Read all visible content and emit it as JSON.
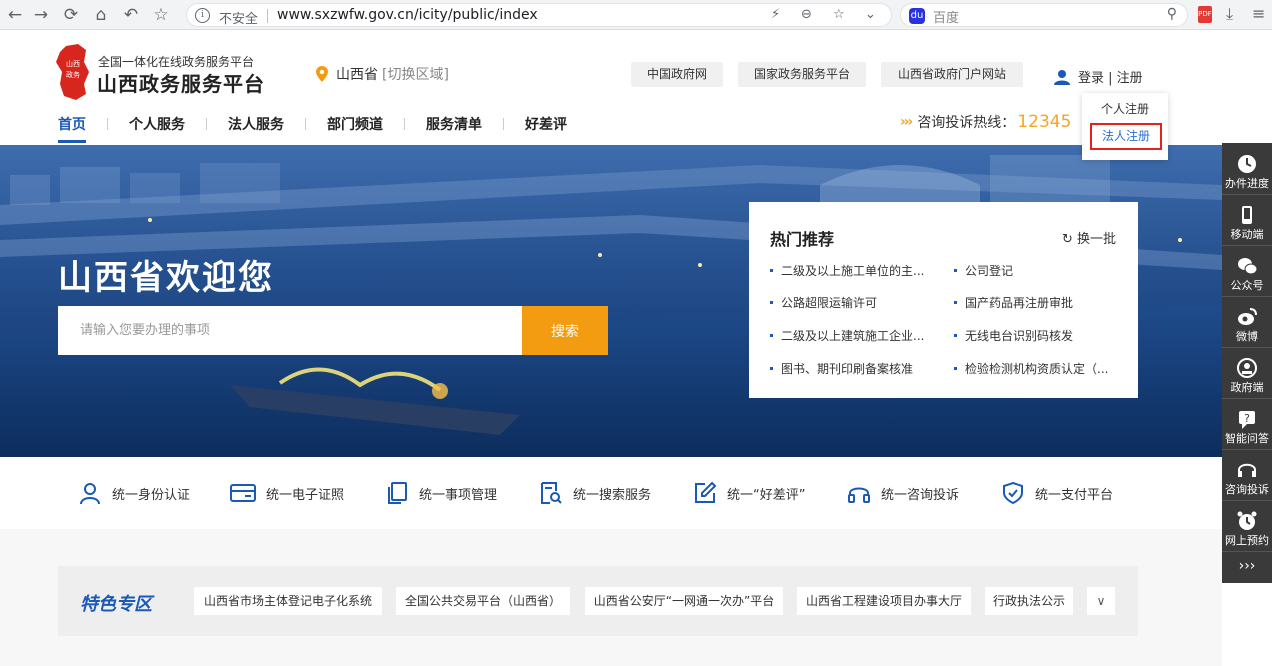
{
  "browser": {
    "insecure_label": "不安全",
    "url": "www.sxzwfw.gov.cn/icity/public/index",
    "search_engine": "百度"
  },
  "header": {
    "logo_subtitle": "全国一体化在线政务服务平台",
    "logo_title": "山西政务服务平台",
    "region": "山西省",
    "region_switch": "[切换区域]",
    "top_links": [
      "中国政府网",
      "国家政务服务平台",
      "山西省政府门户网站"
    ],
    "login": "登录 | 注册",
    "dropdown": {
      "personal": "个人注册",
      "corporate": "法人注册"
    },
    "hotline_label": "咨询投诉热线：",
    "hotline_number": "12345"
  },
  "nav": {
    "items": [
      "首页",
      "个人服务",
      "法人服务",
      "部门频道",
      "服务清单",
      "好差评"
    ]
  },
  "banner": {
    "welcome": "山西省欢迎您",
    "search_placeholder": "请输入您要办理的事项",
    "search_button": "搜索"
  },
  "hot": {
    "title": "热门推荐",
    "refresh": "换一批",
    "items": [
      "二级及以上施工单位的主...",
      "公司登记",
      "公路超限运输许可",
      "国产药品再注册审批",
      "二级及以上建筑施工企业...",
      "无线电台识别码核发",
      "图书、期刊印刷备案核准",
      "检验检测机构资质认定（..."
    ]
  },
  "services": [
    {
      "label": "统一身份认证",
      "icon": "user-icon"
    },
    {
      "label": "统一电子证照",
      "icon": "card-icon"
    },
    {
      "label": "统一事项管理",
      "icon": "documents-icon"
    },
    {
      "label": "统一搜索服务",
      "icon": "search-document-icon"
    },
    {
      "label": "统一“好差评”",
      "icon": "edit-icon"
    },
    {
      "label": "统一咨询投诉",
      "icon": "headset-icon"
    },
    {
      "label": "统一支付平台",
      "icon": "shield-check-icon"
    }
  ],
  "featured": {
    "label": "特色专区",
    "chips": [
      "山西省市场主体登记电子化系统",
      "全国公共交易平台（山西省）",
      "山西省公安厅“一网通一次办”平台",
      "山西省工程建设项目办事大厅",
      "行政执法公示"
    ]
  },
  "sidebar": {
    "items": [
      "办件进度",
      "移动端",
      "公众号",
      "微博",
      "政府端",
      "智能问答",
      "咨询投诉",
      "网上预约"
    ],
    "more": "›››"
  },
  "colors": {
    "primary": "#1a59b6",
    "accent": "#f39c12",
    "highlight_border": "#e3221b",
    "sidebar": "#3a3a3a"
  }
}
